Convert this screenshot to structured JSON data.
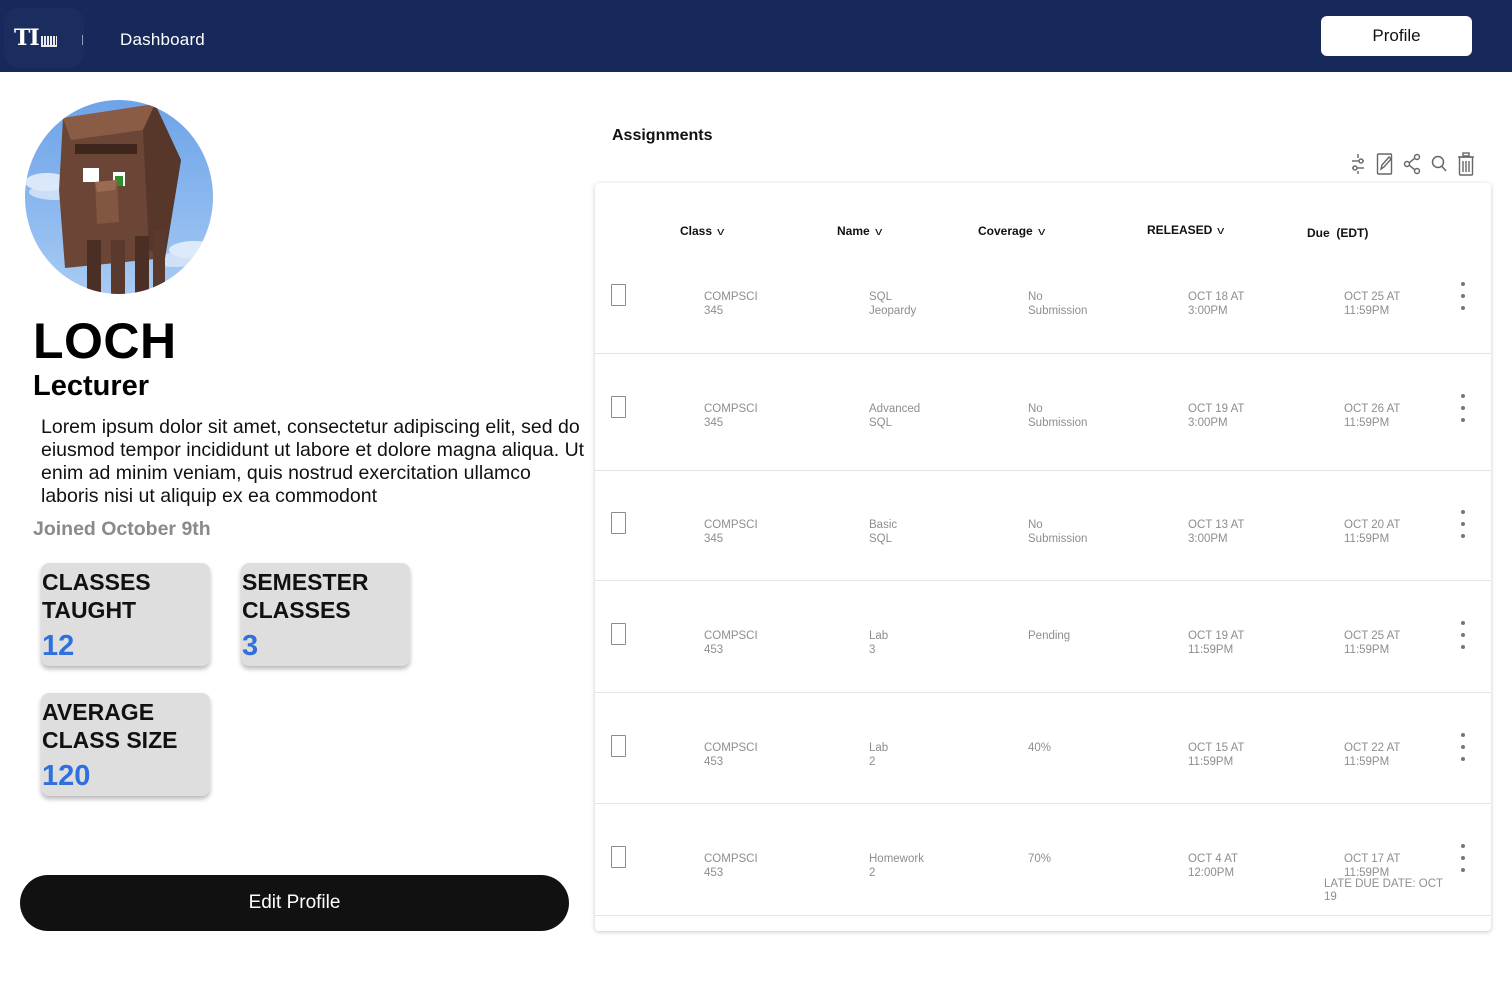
{
  "nav": {
    "logo_text": "TI",
    "dashboard_label": "Dashboard",
    "profile_label": "Profile"
  },
  "profile": {
    "avatar_icon": "villager-avatar",
    "name": "LOCH",
    "role": "Lecturer",
    "bio": "Lorem ipsum dolor sit amet, consectetur adipiscing elit, sed do eiusmod tempor incididunt ut labore et dolore magna aliqua. Ut enim ad minim veniam, quis nostrud exercitation ullamco laboris nisi ut aliquip ex ea commodont",
    "joined": "Joined October 9th",
    "stats": [
      {
        "label": "CLASSES\nTAUGHT",
        "value": "12"
      },
      {
        "label": "SEMESTER\nCLASSES",
        "value": "3"
      },
      {
        "label": "AVERAGE\nCLASS SIZE",
        "value": "120"
      }
    ],
    "edit_label": "Edit Profile"
  },
  "assignments": {
    "title": "Assignments",
    "toolbar_icons": [
      "sliders-icon",
      "edit-icon",
      "share-icon",
      "search-icon",
      "trash-icon"
    ],
    "columns": {
      "class": "Class",
      "name": "Name",
      "coverage": "Coverage",
      "released": "RELEASED",
      "due": "Due  (EDT)"
    },
    "chevron": "v",
    "rows": [
      {
        "class": "COMPSCI\n345",
        "name": "SQL\nJeopardy",
        "coverage": "No\nSubmission",
        "released": "OCT 18 AT\n3:00PM",
        "due": "OCT 25 AT\n11:59PM",
        "late": ""
      },
      {
        "class": "COMPSCI\n345",
        "name": "Advanced\nSQL",
        "coverage": "No\nSubmission",
        "released": "OCT 19 AT\n3:00PM",
        "due": "OCT 26 AT\n11:59PM",
        "late": ""
      },
      {
        "class": "COMPSCI\n345",
        "name": "Basic\nSQL",
        "coverage": "No\nSubmission",
        "released": "OCT 13 AT\n3:00PM",
        "due": "OCT 20 AT\n11:59PM",
        "late": ""
      },
      {
        "class": "COMPSCI\n453",
        "name": "Lab\n3",
        "coverage": "Pending",
        "released": "OCT 19 AT\n11:59PM",
        "due": "OCT 25 AT\n11:59PM",
        "late": ""
      },
      {
        "class": "COMPSCI\n453",
        "name": "Lab\n2",
        "coverage": "40%",
        "released": "OCT 15 AT\n11:59PM",
        "due": "OCT 22 AT\n11:59PM",
        "late": ""
      },
      {
        "class": "COMPSCI\n453",
        "name": "Homework\n2",
        "coverage": "70%",
        "released": "OCT 4 AT\n12:00PM",
        "due": "OCT 17 AT\n11:59PM",
        "late": "LATE DUE DATE: OCT 19"
      }
    ]
  }
}
